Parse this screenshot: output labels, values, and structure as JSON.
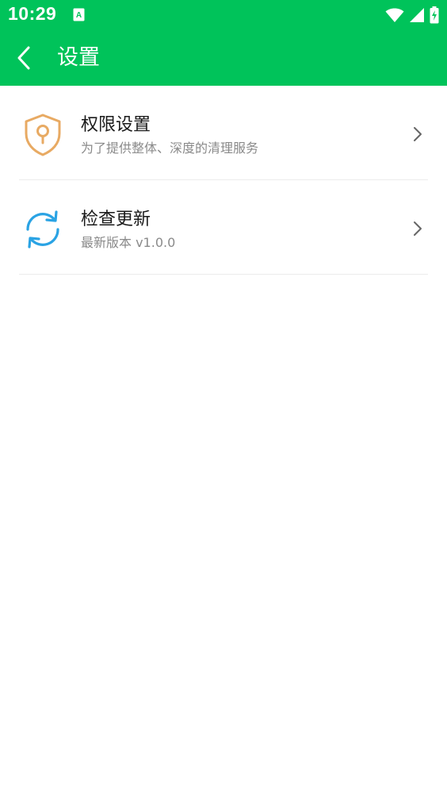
{
  "status_bar": {
    "time": "10:29",
    "notification_icon": "a-keyboard-icon",
    "icons": [
      "wifi-icon",
      "signal-icon",
      "battery-charging-icon"
    ]
  },
  "app_bar": {
    "back_icon": "chevron-left-icon",
    "title": "设置"
  },
  "settings": {
    "items": [
      {
        "icon": "shield-lock-icon",
        "title": "权限设置",
        "subtitle": "为了提供整体、深度的清理服务"
      },
      {
        "icon": "refresh-icon",
        "title": "检查更新",
        "subtitle": "最新版本 v1.0.0"
      }
    ]
  },
  "colors": {
    "primary": "#00c35a",
    "shield": "#e8aa63",
    "refresh": "#2aa3e4",
    "title_text": "#1a1a1a",
    "subtitle_text": "#8a8a8a",
    "divider": "#ececec"
  }
}
